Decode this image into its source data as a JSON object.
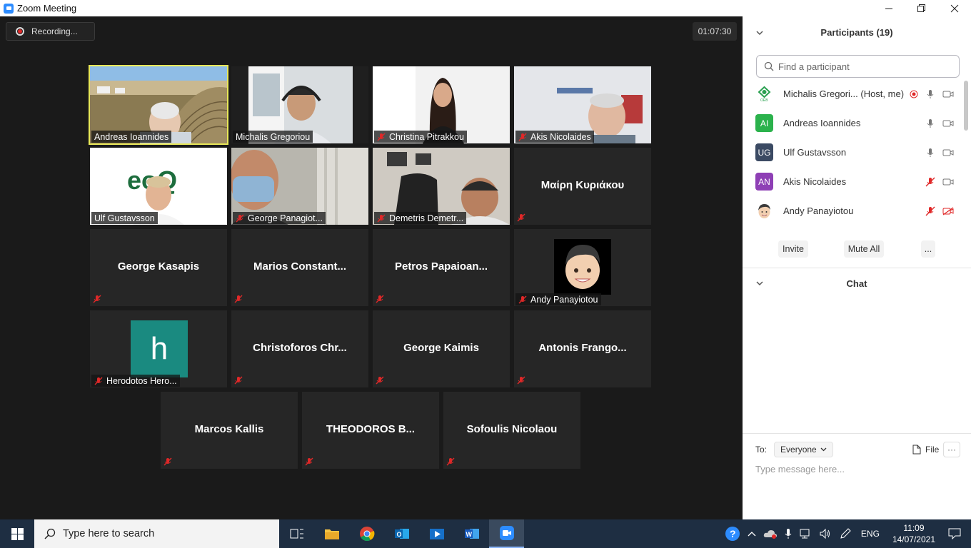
{
  "window": {
    "title": "Zoom Meeting",
    "minimize": "—",
    "maximize": "❐",
    "close": "✕"
  },
  "recording_label": "Recording...",
  "timer": "01:07:30",
  "tiles": [
    {
      "name": "Andreas Ioannides",
      "kind": "video",
      "muted": false
    },
    {
      "name": "Michalis Gregoriou",
      "kind": "video",
      "muted": false
    },
    {
      "name": "Christina Pitrakkou",
      "kind": "video",
      "muted": true
    },
    {
      "name": "Akis Nicolaides",
      "kind": "video",
      "muted": true
    },
    {
      "name": "Ulf Gustavsson",
      "kind": "video",
      "muted": false
    },
    {
      "name": "George Panagiot...",
      "kind": "video",
      "muted": true
    },
    {
      "name": "Demetris Demetr...",
      "kind": "video",
      "muted": true
    },
    {
      "name": "Μαίρη Κυριάκου",
      "kind": "name",
      "muted": true
    },
    {
      "name": "George Kasapis",
      "kind": "name",
      "muted": true
    },
    {
      "name": "Marios Constant...",
      "kind": "name",
      "muted": true
    },
    {
      "name": "Petros Papaioan...",
      "kind": "name",
      "muted": true
    },
    {
      "name": "Andy Panayiotou",
      "kind": "avatar",
      "muted": true
    },
    {
      "name": "Herodotos Hero...",
      "kind": "letter",
      "letter": "h",
      "muted": true
    },
    {
      "name": "Christoforos Chr...",
      "kind": "name",
      "muted": true
    },
    {
      "name": "George Kaimis",
      "kind": "name",
      "muted": true
    },
    {
      "name": "Antonis Frango...",
      "kind": "name",
      "muted": true
    },
    {
      "name": "Marcos Kallis",
      "kind": "name",
      "muted": true
    },
    {
      "name": "THEODOROS B...",
      "kind": "name",
      "muted": true
    },
    {
      "name": "Sofoulis Nicolaou",
      "kind": "name",
      "muted": true
    }
  ],
  "panel": {
    "participants_title": "Participants (19)",
    "search_placeholder": "Find a participant",
    "participants": [
      {
        "name": "Michalis Gregori... (Host, me)",
        "initials": "",
        "color": "#ffffff",
        "mic": "on",
        "video": "off",
        "recording": true
      },
      {
        "name": "Andreas Ioannides",
        "initials": "AI",
        "color": "#2bb24c",
        "mic": "on",
        "video": "off",
        "recording": false
      },
      {
        "name": "Ulf Gustavsson",
        "initials": "UG",
        "color": "#3b4a63",
        "mic": "on",
        "video": "off",
        "recording": false
      },
      {
        "name": "Akis Nicolaides",
        "initials": "AN",
        "color": "#8e3fb5",
        "mic": "muted",
        "video": "off",
        "recording": false
      },
      {
        "name": "Andy Panayiotou",
        "initials": "",
        "color": "#ffffff",
        "mic": "muted",
        "video": "stopped",
        "recording": false
      }
    ],
    "invite": "Invite",
    "mute_all": "Mute All",
    "more": "...",
    "chat_title": "Chat",
    "to_label": "To:",
    "to_value": "Everyone",
    "file_label": "File",
    "more_options": "···",
    "message_placeholder": "Type message here..."
  },
  "taskbar": {
    "search_placeholder": "Type here to search",
    "lang": "ENG",
    "time": "11:09",
    "date": "14/07/2021"
  },
  "colors": {
    "accent": "#2d8cff",
    "muted_red": "#e02828",
    "active_speaker": "#e8e858"
  }
}
